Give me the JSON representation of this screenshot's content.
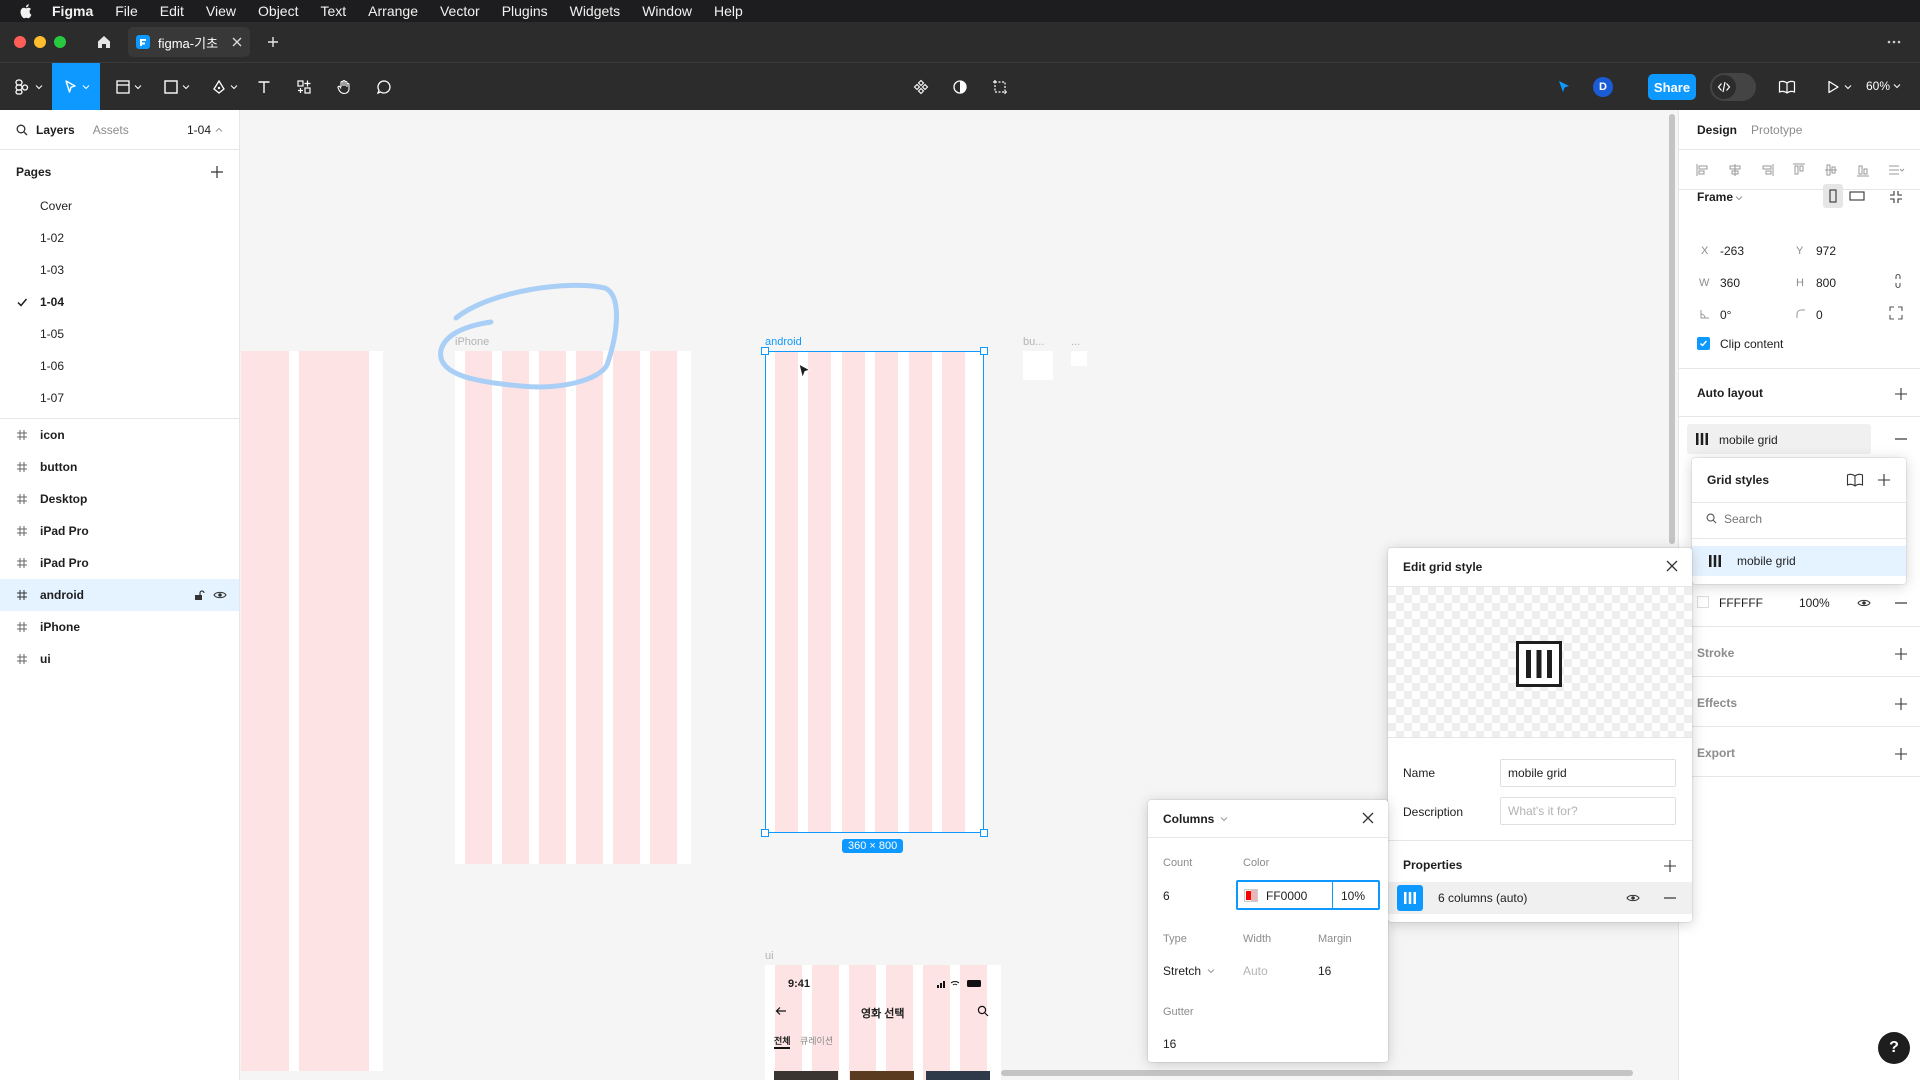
{
  "menubar": {
    "app": "Figma",
    "items": [
      "File",
      "Edit",
      "View",
      "Object",
      "Text",
      "Arrange",
      "Vector",
      "Plugins",
      "Widgets",
      "Window",
      "Help"
    ]
  },
  "tabbar": {
    "file_tab": "figma-기초"
  },
  "toolbar": {
    "share_label": "Share",
    "avatar_initial": "D",
    "zoom": "60%"
  },
  "left_panel": {
    "tabs": {
      "layers": "Layers",
      "assets": "Assets",
      "page_selector": "1-04"
    },
    "pages_heading": "Pages",
    "pages": [
      "Cover",
      "1-02",
      "1-03",
      "1-04",
      "1-05",
      "1-06",
      "1-07"
    ],
    "current_page": "1-04",
    "layers": [
      "icon",
      "button",
      "Desktop",
      "iPad Pro",
      "iPad Pro",
      "android",
      "iPhone",
      "ui"
    ],
    "selected_layer": "android"
  },
  "canvas": {
    "frames": {
      "iphone": "iPhone",
      "android": "android",
      "bu": "bu...",
      "dots": "...",
      "ui": "ui"
    },
    "size_badge": "360 × 800",
    "ui_preview": {
      "time": "9:41",
      "title": "영화 선택",
      "tab_all": "전체",
      "tab_curation": "큐레이션"
    }
  },
  "right_panel": {
    "tabs": {
      "design": "Design",
      "prototype": "Prototype"
    },
    "frame_label": "Frame",
    "x_label": "X",
    "x": "-263",
    "y_label": "Y",
    "y": "972",
    "w_label": "W",
    "w": "360",
    "h_label": "H",
    "h": "800",
    "rotation": "0°",
    "radius": "0",
    "clip_content": "Clip content",
    "auto_layout": "Auto layout",
    "grid_name": "mobile grid",
    "fill_hex": "FFFFFF",
    "fill_opacity": "100%",
    "stroke": "Stroke",
    "effects": "Effects",
    "export": "Export"
  },
  "grid_styles_popover": {
    "title": "Grid styles",
    "search_placeholder": "Search",
    "item": "mobile grid"
  },
  "edit_grid_popover": {
    "title": "Edit grid style",
    "name_label": "Name",
    "name_value": "mobile grid",
    "description_label": "Description",
    "description_placeholder": "What's it for?",
    "properties_label": "Properties",
    "property_item": "6 columns (auto)"
  },
  "columns_popover": {
    "title": "Columns",
    "count_label": "Count",
    "count": "6",
    "color_label": "Color",
    "color_hex": "FF0000",
    "color_opacity": "10%",
    "type_label": "Type",
    "type_value": "Stretch",
    "width_label": "Width",
    "width_value": "Auto",
    "margin_label": "Margin",
    "margin_value": "16",
    "gutter_label": "Gutter",
    "gutter_value": "16"
  },
  "colors": {
    "accent": "#0d99ff",
    "grid_column": "#fde3e3",
    "grid_red": "#ff0000",
    "chrome_dark": "#2c2c2c"
  }
}
